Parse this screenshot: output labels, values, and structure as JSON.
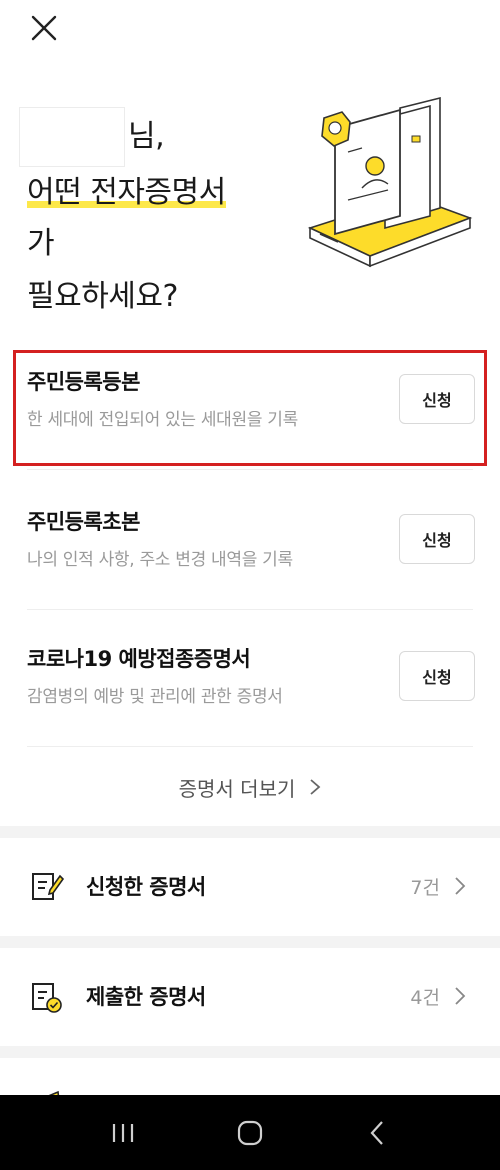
{
  "header": {
    "close_icon": "close-icon"
  },
  "hero": {
    "name_suffix": "님,",
    "line2": "어떤 전자증명서",
    "line3": "가",
    "line4": "필요하세요?",
    "accent_color": "#fde84a"
  },
  "documents": [
    {
      "title": "주민등록등본",
      "desc": "한 세대에 전입되어 있는 세대원을 기록",
      "button": "신청"
    },
    {
      "title": "주민등록초본",
      "desc": "나의 인적 사항, 주소 변경 내역을 기록",
      "button": "신청"
    },
    {
      "title": "코로나19 예방접종증명서",
      "desc": "감염병의 예방 및 관리에 관한 증명서",
      "button": "신청"
    }
  ],
  "more": {
    "label": "증명서 더보기"
  },
  "menu": [
    {
      "label": "신청한 증명서",
      "count": "7건",
      "icon": "edit-document-icon"
    },
    {
      "label": "제출한 증명서",
      "count": "4건",
      "icon": "submitted-document-icon"
    }
  ],
  "highlight_color": "#d42020",
  "navbar": {
    "icons": [
      "recent-apps-icon",
      "home-icon",
      "back-icon"
    ]
  }
}
